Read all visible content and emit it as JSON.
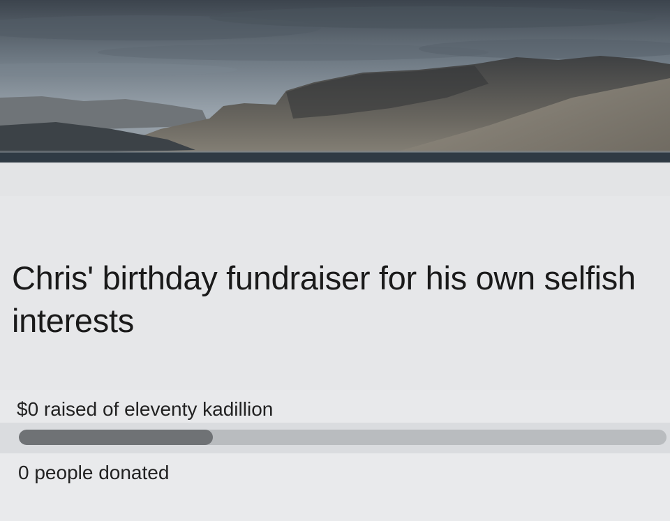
{
  "cover": {
    "description_icon": "landscape-cover-photo",
    "colors": {
      "sky_dark": "#3f4852",
      "sky_light": "#8e98a2",
      "cliff": "#4a4c4e",
      "water": "#2f3a44"
    }
  },
  "fundraiser": {
    "title": "Chris' birthday fundraiser for his own selfish interests",
    "raised_text": "$0 raised of eleventy kadillion",
    "progress_fraction": 0.3,
    "donors_text": "0 people donated"
  },
  "colors": {
    "progress_fill": "#6f7275",
    "progress_track": "#b9bcbf",
    "text": "#1a1a1a"
  }
}
